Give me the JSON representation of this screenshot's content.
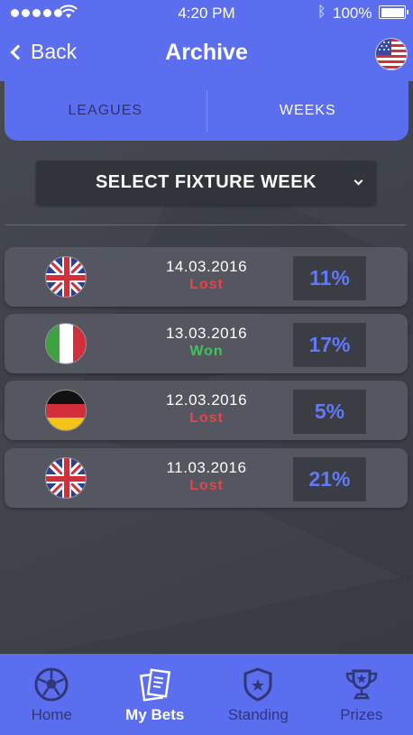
{
  "status_bar": {
    "time": "4:20 PM",
    "battery": "100%",
    "bluetooth_icon": "bluetooth-icon",
    "wifi_icon": "wifi-icon"
  },
  "header": {
    "back_label": "Back",
    "title": "Archive",
    "flag": "us-flag-icon"
  },
  "tabs": [
    {
      "label": "LEAGUES",
      "active": false
    },
    {
      "label": "WEEKS",
      "active": true
    }
  ],
  "select": {
    "label": "SELECT FIXTURE WEEK"
  },
  "rows": [
    {
      "flag": "uk-flag-icon",
      "date": "14.03.2016",
      "result": "Lost",
      "percent": "11%"
    },
    {
      "flag": "italy-flag-icon",
      "date": "13.03.2016",
      "result": "Won",
      "percent": "17%"
    },
    {
      "flag": "germany-flag-icon",
      "date": "12.03.2016",
      "result": "Lost",
      "percent": "5%"
    },
    {
      "flag": "uk-flag-icon",
      "date": "11.03.2016",
      "result": "Lost",
      "percent": "21%"
    }
  ],
  "nav": [
    {
      "label": "Home",
      "icon": "soccer-ball-icon",
      "active": false
    },
    {
      "label": "My Bets",
      "icon": "tickets-icon",
      "active": true
    },
    {
      "label": "Standing",
      "icon": "shield-star-icon",
      "active": false
    },
    {
      "label": "Prizes",
      "icon": "trophy-icon",
      "active": false
    }
  ],
  "colors": {
    "accent": "#5b6ef0",
    "won": "#3fc45a",
    "lost": "#e8434a",
    "percent": "#6279f5"
  }
}
